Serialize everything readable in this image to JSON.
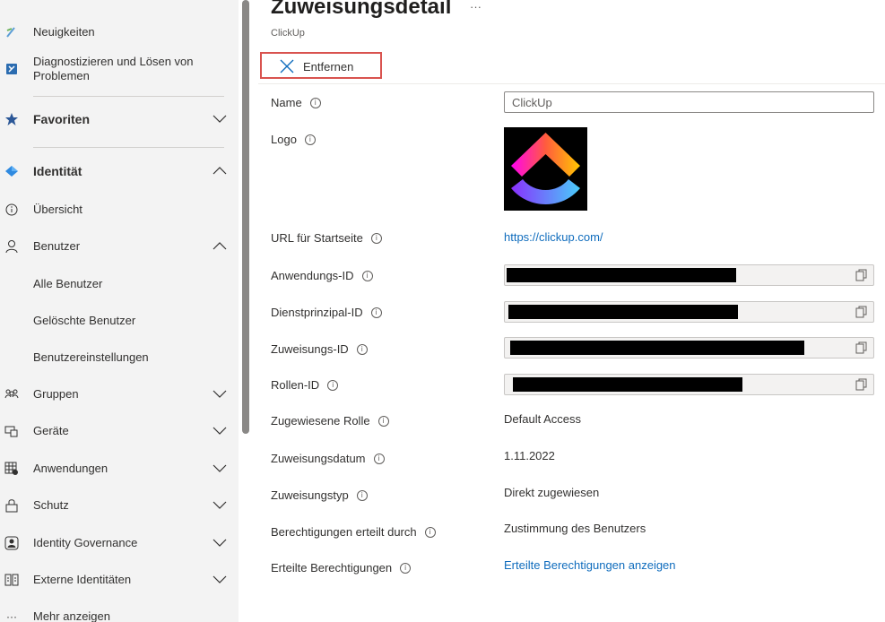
{
  "sidebar": {
    "items": [
      {
        "label": "Neuigkeiten",
        "icon": "news-icon"
      },
      {
        "label": "Diagnostizieren und Lösen von Problemen",
        "icon": "diagnose-icon"
      },
      {
        "label": "Favoriten",
        "icon": "star-icon"
      },
      {
        "label": "Identität",
        "icon": "identity-icon"
      },
      {
        "label": "Übersicht",
        "icon": "info-icon"
      },
      {
        "label": "Benutzer",
        "icon": "user-icon"
      },
      {
        "label": "Alle Benutzer"
      },
      {
        "label": "Gelöschte Benutzer"
      },
      {
        "label": "Benutzereinstellungen"
      },
      {
        "label": "Gruppen",
        "icon": "groups-icon"
      },
      {
        "label": "Geräte",
        "icon": "devices-icon"
      },
      {
        "label": "Anwendungen",
        "icon": "applications-icon"
      },
      {
        "label": "Schutz",
        "icon": "lock-icon"
      },
      {
        "label": "Identity Governance",
        "icon": "governance-icon"
      },
      {
        "label": "Externe Identitäten",
        "icon": "external-identities-icon"
      },
      {
        "label": "Mehr anzeigen",
        "icon": "more-icon"
      }
    ],
    "diag_line1": "Diagnostizieren und Lösen von",
    "diag_line2": "Problemen"
  },
  "header": {
    "title": "Zuweisungsdetail",
    "more": "···",
    "subtitle": "ClickUp"
  },
  "toolbar": {
    "remove_label": "Entfernen"
  },
  "details": {
    "name_label": "Name",
    "name_value": "ClickUp",
    "logo_label": "Logo",
    "homepage_label": "URL für Startseite",
    "homepage_value": "https://clickup.com/",
    "app_id_label": "Anwendungs-ID",
    "sp_id_label": "Dienstprinzipal-ID",
    "assignment_id_label": "Zuweisungs-ID",
    "role_id_label": "Rollen-ID",
    "role_label": "Zugewiesene Rolle",
    "role_value": "Default Access",
    "date_label": "Zuweisungsdatum",
    "date_value": "1.11.2022",
    "type_label": "Zuweisungstyp",
    "type_value": "Direkt zugewiesen",
    "granted_by_label": "Berechtigungen erteilt durch",
    "granted_by_value": "Zustimmung des Benutzers",
    "permissions_label": "Erteilte Berechtigungen",
    "permissions_value": "Erteilte Berechtigungen anzeigen"
  },
  "colors": {
    "accent": "#0f6cbd",
    "highlight_border": "#d9534f",
    "sidebar_bg": "#f3f3f3"
  }
}
